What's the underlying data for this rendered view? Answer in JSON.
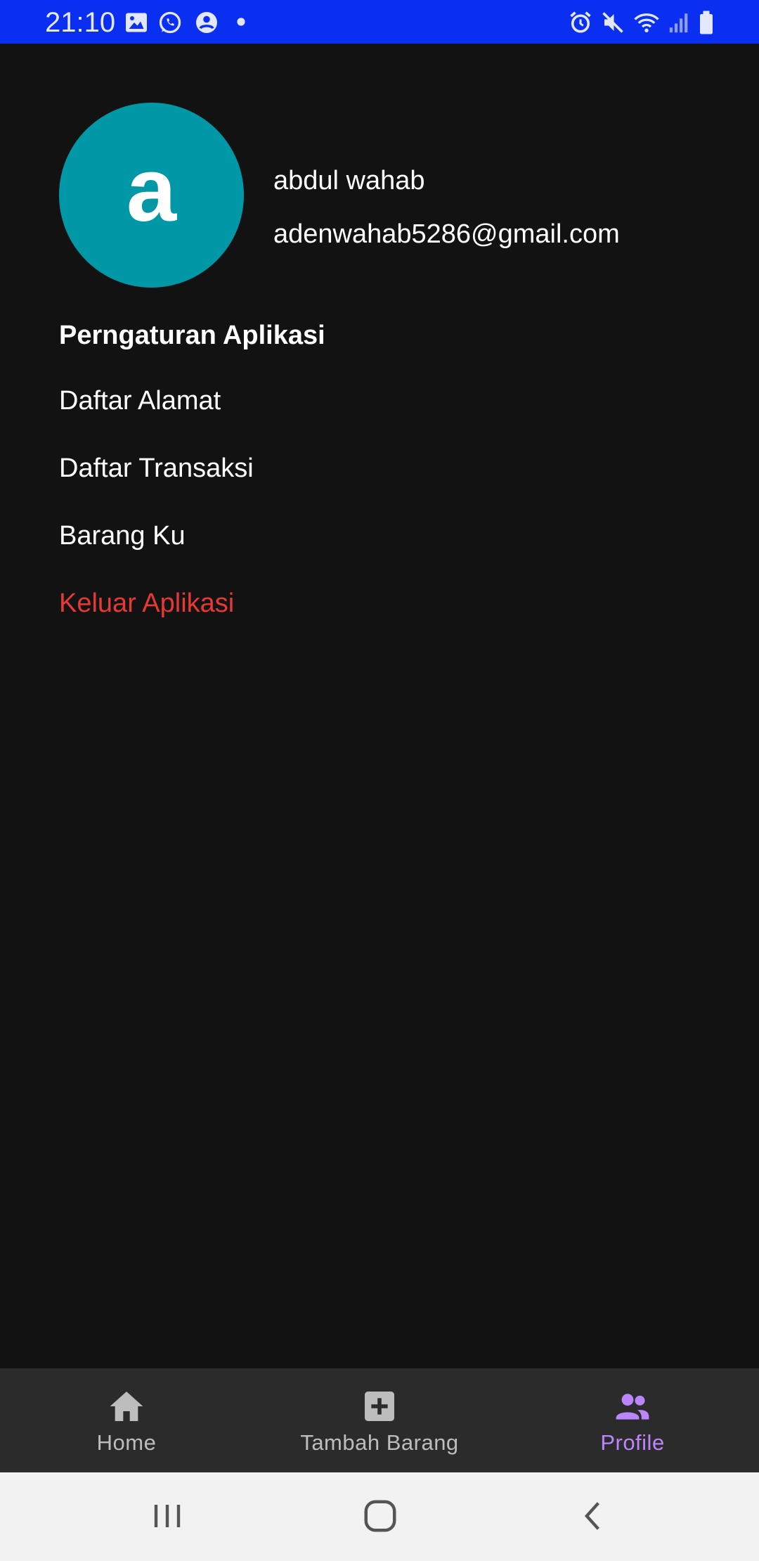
{
  "status_bar": {
    "time": "21:10",
    "left_icons": [
      "image-icon",
      "whatsapp-icon",
      "account-circle-icon",
      "dot-icon"
    ],
    "right_icons": [
      "alarm-icon",
      "mute-icon",
      "wifi-icon",
      "signal-icon",
      "battery-icon"
    ],
    "background": "#0a2ff0"
  },
  "profile": {
    "avatar_letter": "a",
    "avatar_color": "#0097a7",
    "name": "abdul wahab",
    "email": "adenwahab5286@gmail.com"
  },
  "settings": {
    "title": "Perngaturan Aplikasi",
    "items": [
      {
        "label": "Daftar Alamat"
      },
      {
        "label": "Daftar Transaksi"
      },
      {
        "label": "Barang Ku"
      }
    ],
    "logout_label": "Keluar Aplikasi",
    "logout_color": "#e53935"
  },
  "bottom_nav": {
    "items": [
      {
        "label": "Home",
        "icon": "home-icon",
        "active": false
      },
      {
        "label": "Tambah Barang",
        "icon": "add-box-icon",
        "active": false
      },
      {
        "label": "Profile",
        "icon": "people-icon",
        "active": true
      }
    ],
    "active_color": "#bb86fc"
  },
  "system_nav": {
    "buttons": [
      "recents-icon",
      "home-circle-icon",
      "back-icon"
    ]
  }
}
